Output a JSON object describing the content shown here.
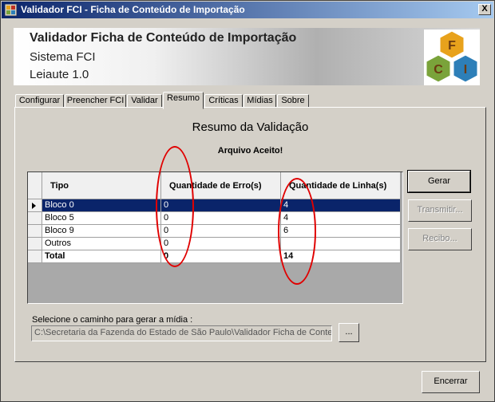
{
  "window": {
    "title": "Validador FCI - Ficha de Conteúdo de Importação",
    "close_label": "X"
  },
  "header": {
    "title": "Validador Ficha de Conteúdo de Importação",
    "subtitle": "Sistema FCI",
    "version": "Leiaute 1.0",
    "logo_letters": [
      "F",
      "C",
      "I"
    ],
    "logo_colors": {
      "F": "#e8a21c",
      "C": "#7aa33a",
      "I": "#2d7fb8"
    }
  },
  "tabs": [
    {
      "label": "Configurar",
      "active": false
    },
    {
      "label": "Preencher FCI",
      "active": false
    },
    {
      "label": "Validar",
      "active": false
    },
    {
      "label": "Resumo",
      "active": true
    },
    {
      "label": "Críticas",
      "active": false
    },
    {
      "label": "Mídias",
      "active": false
    },
    {
      "label": "Sobre",
      "active": false
    }
  ],
  "resumo": {
    "title": "Resumo da Validação",
    "status": "Arquivo Aceito!",
    "columns": [
      "Tipo",
      "Quantidade de Erro(s)",
      "Quantidade de Linha(s)"
    ],
    "rows": [
      {
        "tipo": "Bloco 0",
        "erros": "0",
        "linhas": "4",
        "selected": true
      },
      {
        "tipo": "Bloco 5",
        "erros": "0",
        "linhas": "4",
        "selected": false
      },
      {
        "tipo": "Bloco 9",
        "erros": "0",
        "linhas": "6",
        "selected": false
      },
      {
        "tipo": "Outros",
        "erros": "0",
        "linhas": "",
        "selected": false
      },
      {
        "tipo": "Total",
        "erros": "0",
        "linhas": "14",
        "selected": false,
        "bold": true
      }
    ]
  },
  "buttons": {
    "gerar": "Gerar",
    "transmitir": "Transmitir...",
    "recibo": "Recibo...",
    "browse": "...",
    "encerrar": "Encerrar"
  },
  "path": {
    "label": "Selecione o caminho para gerar a mídia :",
    "value": "C:\\Secretaria da Fazenda do Estado de São Paulo\\Validador Ficha de Conteú"
  },
  "colors": {
    "annotation": "#e00000",
    "selection": "#0a246a",
    "titlebar": "#0a246a"
  }
}
